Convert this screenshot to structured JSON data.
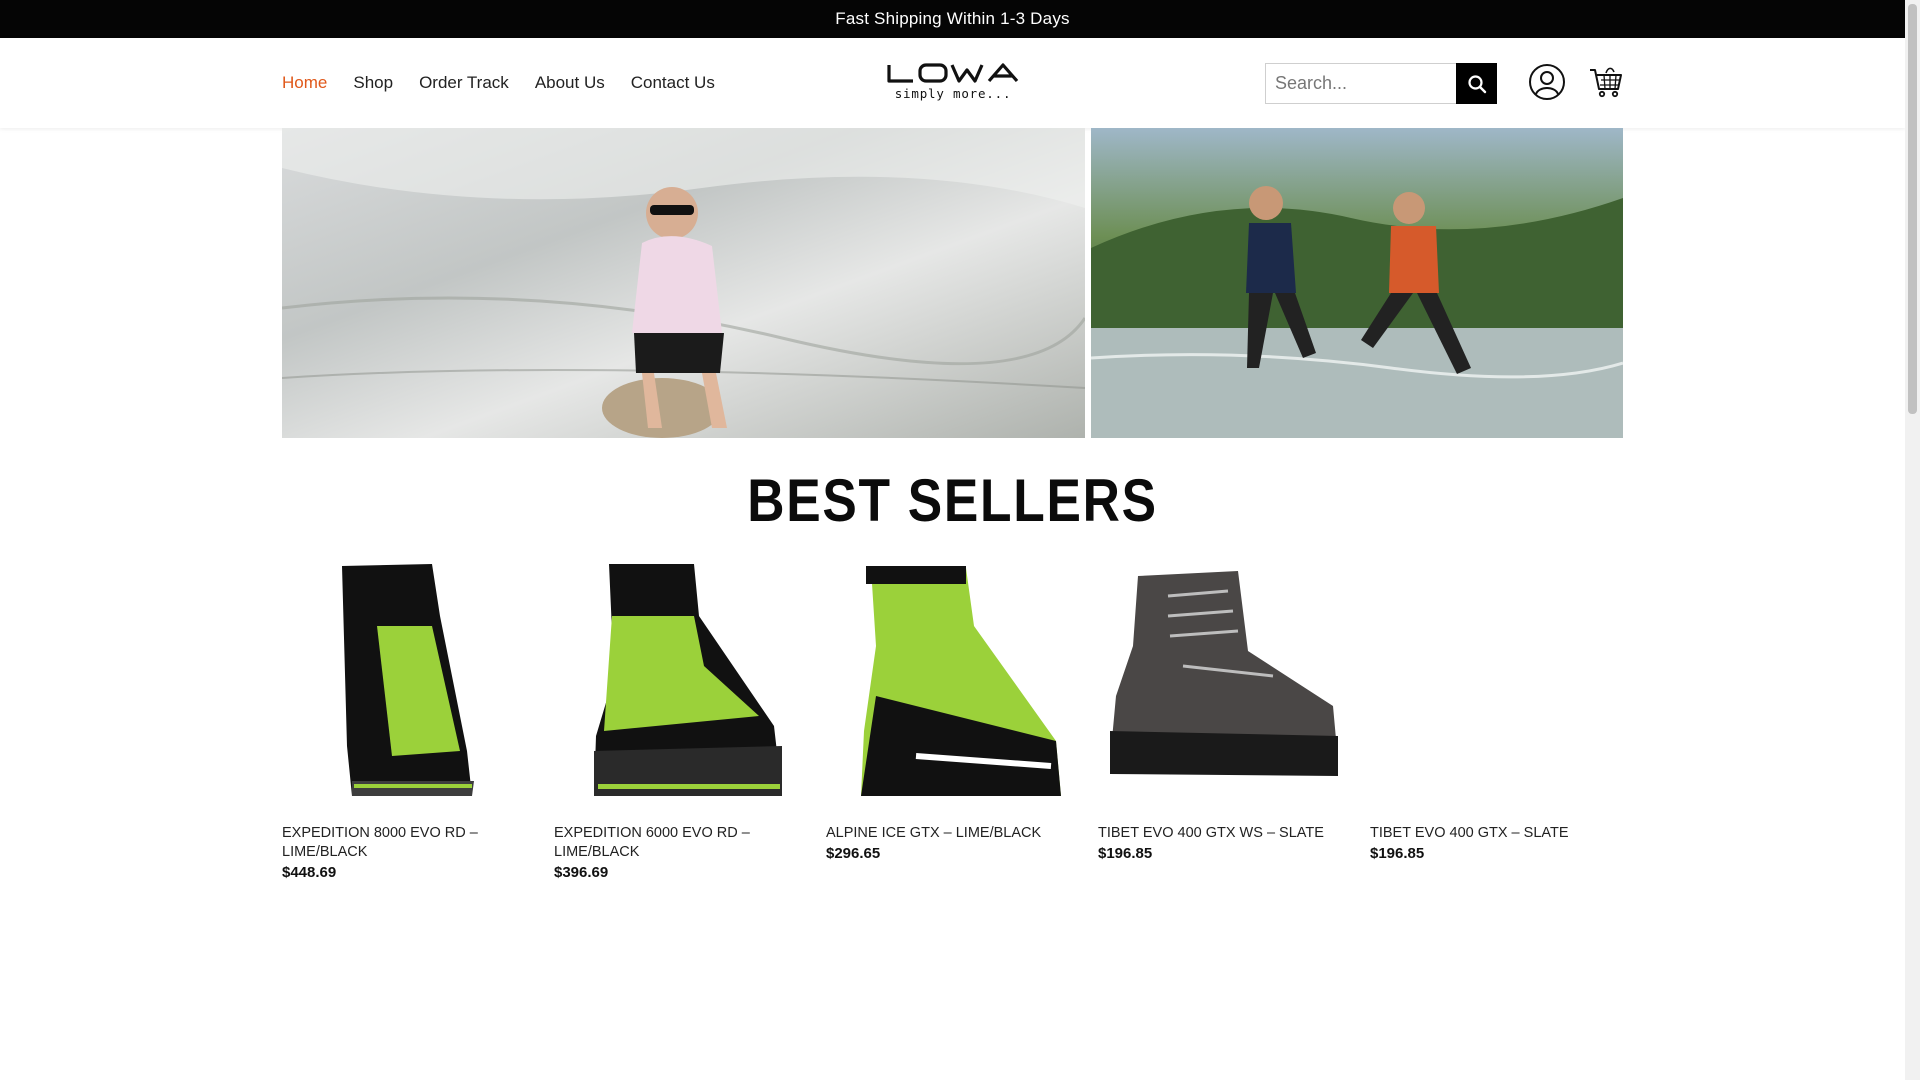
{
  "announcement": "Fast Shipping Within 1-3 Days",
  "nav": {
    "items": [
      {
        "label": "Home",
        "active": true
      },
      {
        "label": "Shop",
        "active": false
      },
      {
        "label": "Order Track",
        "active": false
      },
      {
        "label": "About Us",
        "active": false
      },
      {
        "label": "Contact Us",
        "active": false
      }
    ]
  },
  "logo": {
    "wordmark": "LOWA",
    "tagline": "simply more..."
  },
  "search": {
    "placeholder": "Search...",
    "value": ""
  },
  "icons": {
    "search": "search-icon",
    "account": "user-icon",
    "cart": "cart-icon"
  },
  "colors": {
    "accent": "#e0581a",
    "lime": "#9bd13a",
    "black": "#050505"
  },
  "section_title": "BEST SELLERS",
  "products": [
    {
      "name": "EXPEDITION 8000 EVO RD – LIME/BLACK",
      "price": "$448.69"
    },
    {
      "name": "EXPEDITION 6000 EVO RD – LIME/BLACK",
      "price": "$396.69"
    },
    {
      "name": "ALPINE ICE GTX – LIME/BLACK",
      "price": "$296.65"
    },
    {
      "name": "TIBET EVO 400 GTX WS – SLATE",
      "price": "$196.85"
    },
    {
      "name": "TIBET EVO 400 GTX – SLATE",
      "price": "$196.85"
    }
  ]
}
